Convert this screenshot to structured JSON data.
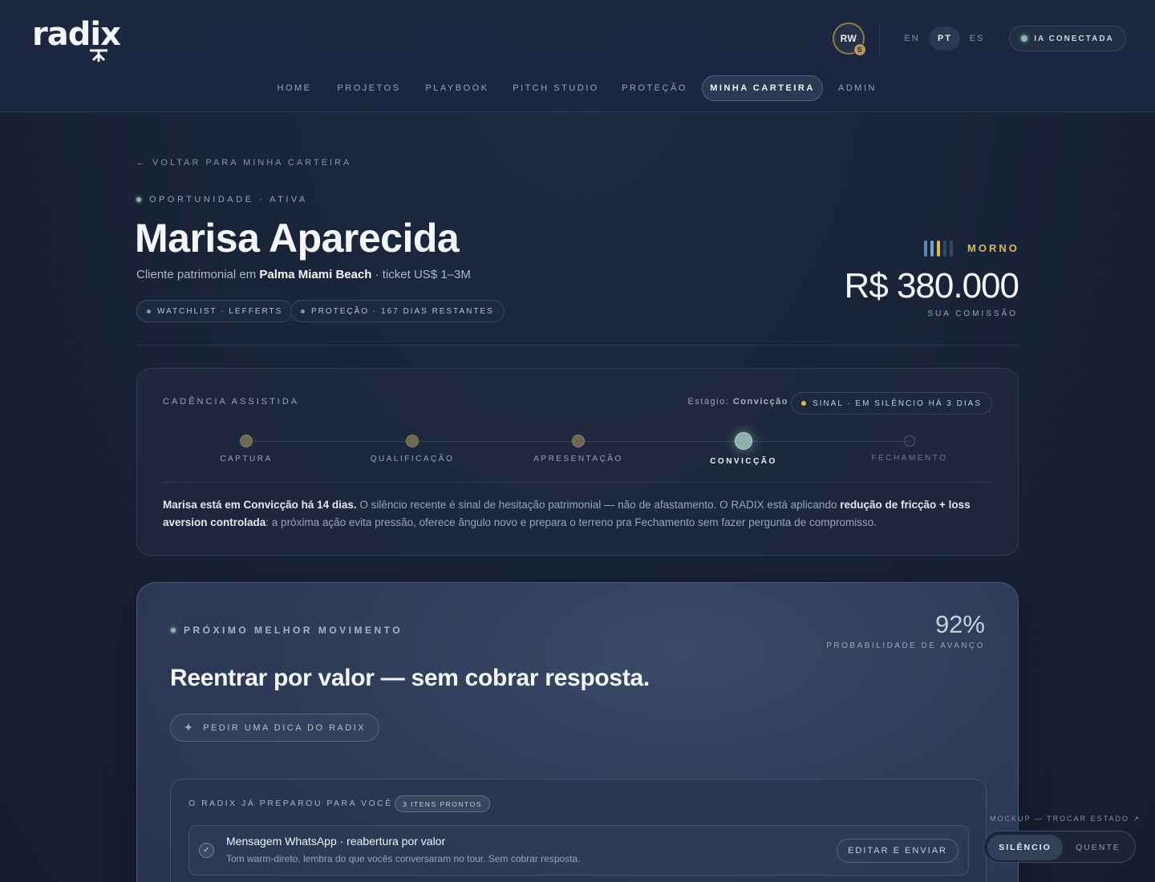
{
  "header": {
    "logo_text": "radix",
    "avatar": {
      "initials": "RW",
      "badge": "S"
    },
    "languages": [
      {
        "label": "EN",
        "active": false
      },
      {
        "label": "PT",
        "active": true
      },
      {
        "label": "ES",
        "active": false
      }
    ],
    "ai_status": "IA CONECTADA",
    "nav": [
      {
        "label": "HOME",
        "active": false
      },
      {
        "label": "PROJETOS",
        "active": false
      },
      {
        "label": "PLAYBOOK",
        "active": false
      },
      {
        "label": "PITCH STUDIO",
        "active": false
      },
      {
        "label": "PROTEÇÃO",
        "active": false
      },
      {
        "label": "MINHA CARTEIRA",
        "active": true
      },
      {
        "label": "ADMIN",
        "active": false
      }
    ]
  },
  "hero": {
    "back_link": "← VOLTAR PARA MINHA CARTEIRA",
    "eyebrow": "OPORTUNIDADE · ATIVA",
    "client_name": "Marisa Aparecida",
    "subtitle_prefix": "Cliente patrimonial em ",
    "subtitle_location": "Palma Miami Beach",
    "subtitle_suffix": " · ticket US$ 1–3M",
    "tags": [
      "WATCHLIST · LEFFERTS",
      "PROTEÇÃO · 167 DIAS RESTANTES"
    ],
    "temperature": {
      "label": "MORNO",
      "bars": [
        "#5d86b8",
        "#7aa0c8",
        "#d9b85c",
        "#3a4660",
        "#3a4660"
      ]
    },
    "commission_value": "R$ 380.000",
    "commission_label": "SUA COMISSÃO"
  },
  "cadence": {
    "title": "CADÊNCIA ASSISTIDA",
    "stage_prefix": "Estágio: ",
    "stage_value": "Convicção",
    "signal": "SINAL · EM SILÊNCIO HÁ 3 DIAS",
    "steps": [
      {
        "label": "CAPTURA",
        "state": "done"
      },
      {
        "label": "QUALIFICAÇÃO",
        "state": "done"
      },
      {
        "label": "APRESENTAÇÃO",
        "state": "done"
      },
      {
        "label": "CONVICÇÃO",
        "state": "current"
      },
      {
        "label": "FECHAMENTO",
        "state": "future"
      }
    ],
    "text_bold_1": "Marisa está em Convicção há 14 dias.",
    "text_1": " O silêncio recente é sinal de hesitação patrimonial — não de afastamento. O RADIX está aplicando ",
    "text_bold_2": "redução de fricção + loss aversion controlada",
    "text_2": ": a próxima ação evita pressão, oferece ângulo novo e prepara o terreno pra Fechamento sem fazer pergunta de compromisso."
  },
  "next_move": {
    "eyebrow": "PRÓXIMO MELHOR MOVIMENTO",
    "probability_value": "92%",
    "probability_label": "PROBABILIDADE DE AVANÇO",
    "title": "Reentrar por valor — sem cobrar resposta.",
    "tip_button": "PEDIR UMA DICA DO RADIX",
    "prepared": {
      "title": "O RADIX JÁ PREPAROU PARA VOCÊ",
      "badge": "3 ITENS PRONTOS",
      "items": [
        {
          "title": "Mensagem WhatsApp · reabertura por valor",
          "description": "Tom warm-direto, lembra do que vocês conversaram no tour. Sem cobrar resposta.",
          "action": "EDITAR E ENVIAR"
        }
      ]
    }
  },
  "mockup": {
    "label": "MOCKUP — TROCAR ESTADO ↗",
    "options": [
      {
        "label": "SILÊNCIO",
        "active": true
      },
      {
        "label": "QUENTE",
        "active": false
      }
    ]
  }
}
